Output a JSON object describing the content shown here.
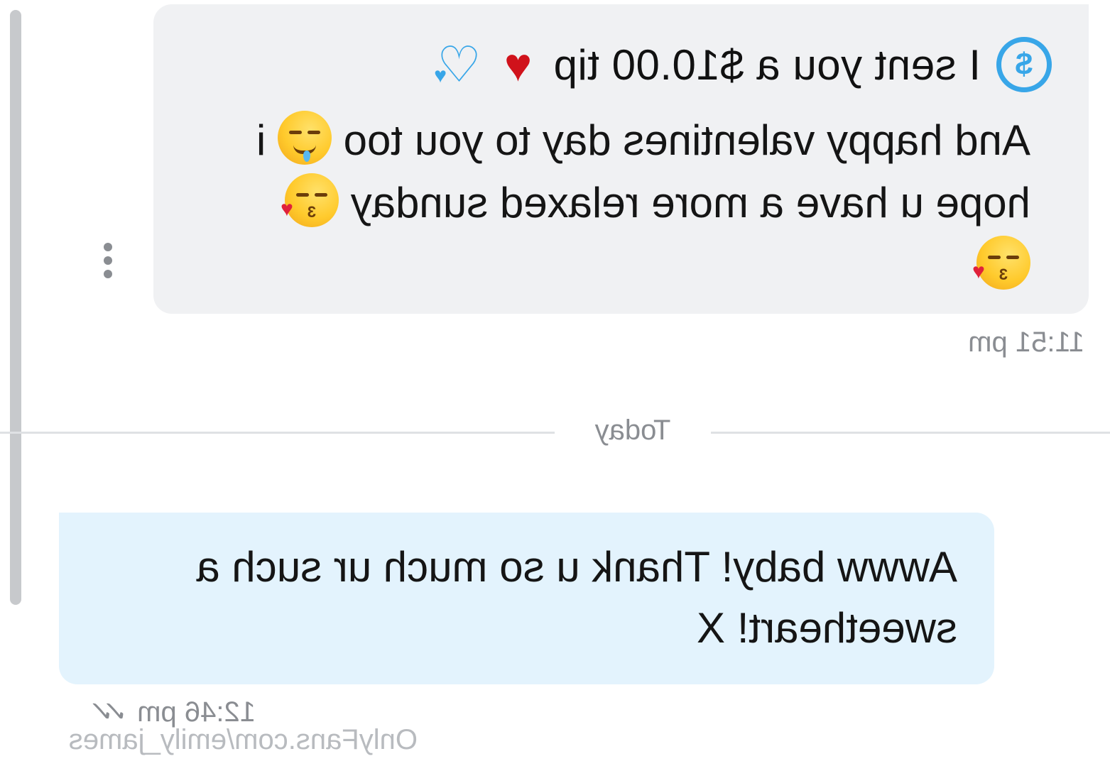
{
  "incoming_message": {
    "tip_text": "I sent you a $10.00 tip",
    "tip_coin_symbol": "$",
    "line_1": "And happy valentines day to you too",
    "line_1_tail": "i",
    "line_2": "hope u have a more relaxed sunday",
    "timestamp": "11:51 pm",
    "icons": [
      "dollar-coin-icon",
      "red-heart-icon",
      "like-heart-icon",
      "drooling-face-emoji",
      "kissing-heart-emoji"
    ]
  },
  "divider": {
    "label": "Today"
  },
  "outgoing_message": {
    "text": "Awww baby! Thank u so much ur such a sweetheart! X",
    "timestamp": "12:46 pm",
    "status_icon": "double-check-icon"
  },
  "watermark": {
    "text": "OnlyFans.com/emily_james"
  },
  "colors": {
    "incoming_bubble": "#f0f1f3",
    "outgoing_bubble": "#e3f3fd",
    "accent_blue": "#38a6e8",
    "heart_red": "#d0121b",
    "meta_gray": "#8a8d92"
  }
}
